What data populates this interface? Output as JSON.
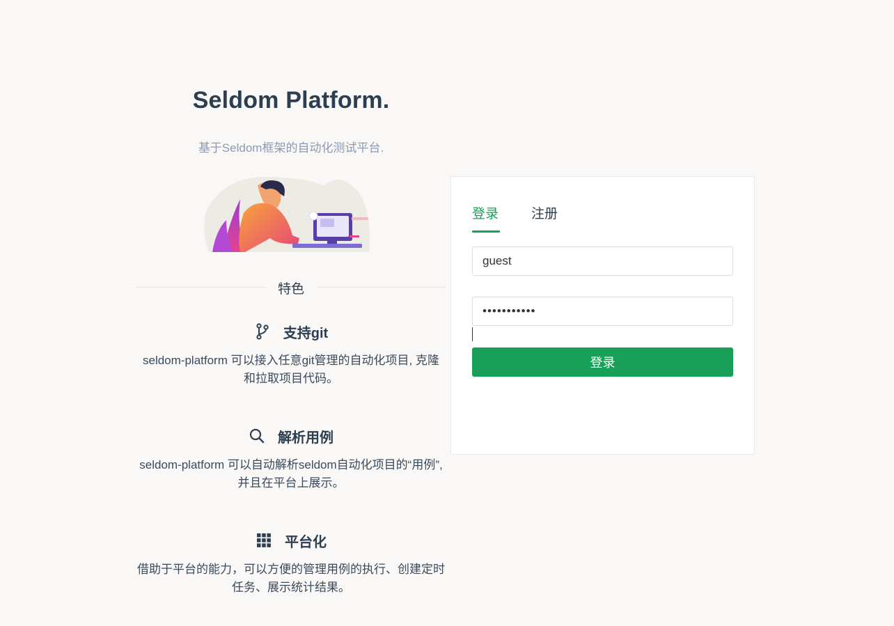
{
  "hero": {
    "title": "Seldom Platform.",
    "subtitle": "基于Seldom框架的自动化测试平台."
  },
  "features_divider": "特色",
  "features": [
    {
      "icon": "git-branch-icon",
      "title": "支持git",
      "description": "seldom-platform 可以接入任意git管理的自动化项目, 克隆和拉取项目代码。"
    },
    {
      "icon": "search-icon",
      "title": "解析用例",
      "description": "seldom-platform 可以自动解析seldom自动化项目的“用例”, 并且在平台上展示。"
    },
    {
      "icon": "grid-icon",
      "title": "平台化",
      "description": "借助于平台的能力，可以方便的管理用例的执行、创建定时任务、展示统计结果。"
    }
  ],
  "auth": {
    "tabs": [
      {
        "label": "登录",
        "active": true
      },
      {
        "label": "注册",
        "active": false
      }
    ],
    "username_value": "guest",
    "password_value": "•••••••••••",
    "login_button": "登录"
  },
  "colors": {
    "accent": "#18a058",
    "background": "#f9f8f6",
    "text": "#2c3e50",
    "subtitle": "#8a9ab5"
  }
}
